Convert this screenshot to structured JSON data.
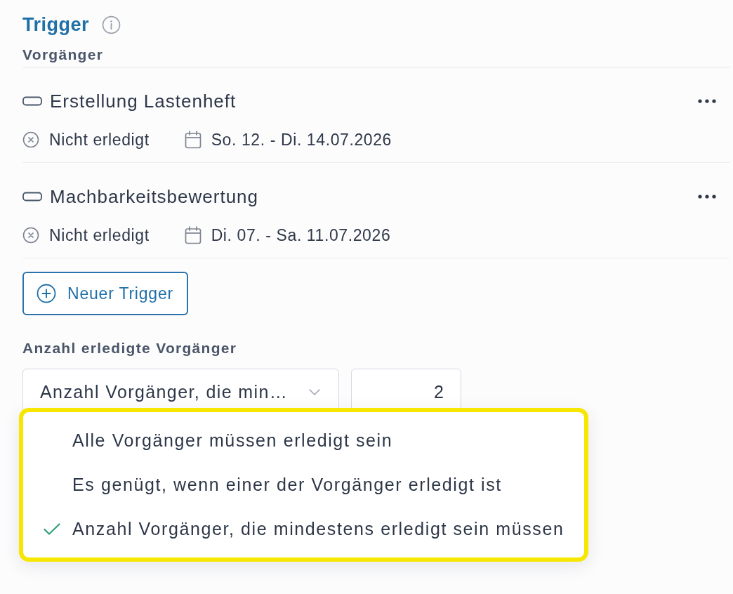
{
  "section": {
    "title": "Trigger",
    "subtitle": "Vorgänger"
  },
  "predecessors": [
    {
      "name": "Erstellung Lastenheft",
      "done": false,
      "status": "Nicht erledigt",
      "dates": "So. 12. - Di. 14.07.2026"
    },
    {
      "name": "Machbarkeitsbewertung",
      "done": false,
      "status": "Nicht erledigt",
      "dates": "Di. 07. - Sa. 11.07.2026"
    }
  ],
  "add_button": {
    "label": "Neuer Trigger"
  },
  "count_setting": {
    "label": "Anzahl erledigte Vorgänger",
    "select": {
      "value": "Anzahl Vorgänger, die min…",
      "expanded": true
    },
    "number": {
      "value": "2"
    }
  },
  "dropdown": {
    "highlighted": true,
    "options": [
      {
        "label": "Alle Vorgänger müssen erledigt sein",
        "selected": false
      },
      {
        "label": "Es genügt, wenn einer der Vorgänger erledigt ist",
        "selected": false
      },
      {
        "label": "Anzahl Vorgänger, die mindestens erledigt sein müssen",
        "selected": true
      }
    ]
  }
}
